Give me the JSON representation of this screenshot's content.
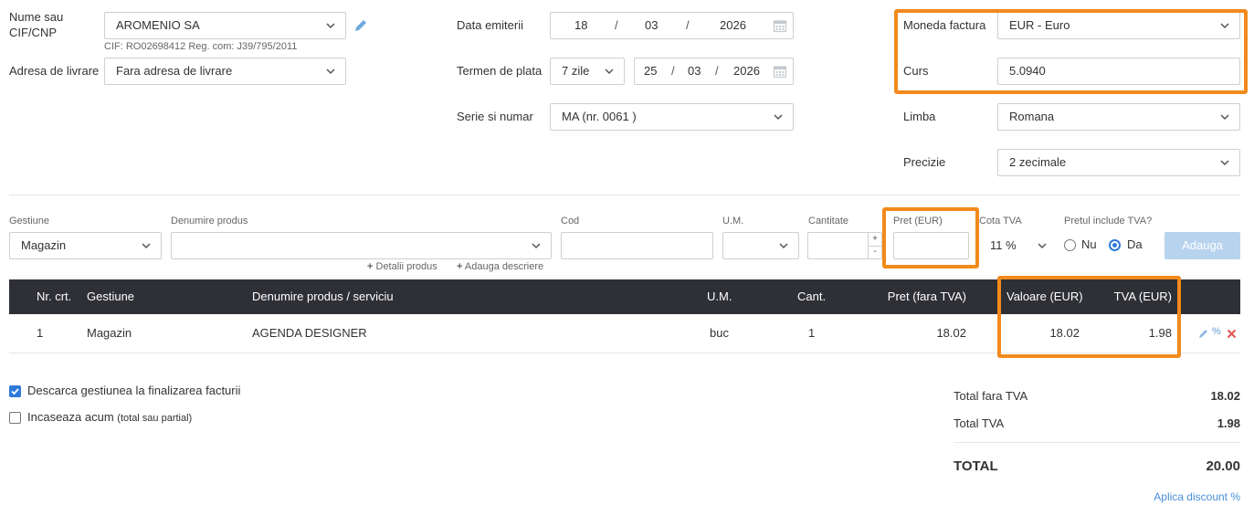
{
  "client": {
    "name_label": "Nume sau CIF/CNP",
    "name_value": "AROMENIO SA",
    "cif_info": "CIF: RO02698412 Reg. com: J39/795/2011",
    "address_label": "Adresa de livrare",
    "address_value": "Fara adresa de livrare"
  },
  "dates": {
    "issue_label": "Data emiterii",
    "issue_day": "18",
    "issue_month": "03",
    "issue_year": "2026",
    "term_label": "Termen de plata",
    "term_value": "7 zile",
    "due_day": "25",
    "due_month": "03",
    "due_year": "2026",
    "separator": "/",
    "series_label": "Serie si numar",
    "series_value": "MA (nr. 0061 )"
  },
  "settings": {
    "currency_label": "Moneda factura",
    "currency_value": "EUR - Euro",
    "rate_label": "Curs",
    "rate_value": "5.0940",
    "language_label": "Limba",
    "language_value": "Romana",
    "precision_label": "Precizie",
    "precision_value": "2 zecimale"
  },
  "product_form": {
    "stock_label": "Gestiune",
    "stock_value": "Magazin",
    "product_label": "Denumire produs",
    "product_value": "",
    "code_label": "Cod",
    "um_label": "U.M.",
    "qty_label": "Cantitate",
    "price_label": "Pret (EUR)",
    "vat_label": "Cota TVA",
    "vat_value": "11 %",
    "includes_vat_label": "Pretul include TVA?",
    "no_label": "Nu",
    "yes_label": "Da",
    "add_button": "Adauga",
    "product_details": "Detalii produs",
    "add_description": "Adauga descriere",
    "plus": "+",
    "minus": "-"
  },
  "table": {
    "headers": {
      "nr": "Nr. crt.",
      "stock": "Gestiune",
      "name": "Denumire produs / serviciu",
      "um": "U.M.",
      "qty": "Cant.",
      "price": "Pret (fara TVA)",
      "value": "Valoare (EUR)",
      "vat": "TVA (EUR)"
    },
    "rows": [
      {
        "nr": "1",
        "stock": "Magazin",
        "name": "AGENDA DESIGNER",
        "um": "buc",
        "qty": "1",
        "price": "18.02",
        "value": "18.02",
        "vat": "1.98",
        "discount_icon": "%"
      }
    ]
  },
  "options": {
    "discharge_label": "Descarca gestiunea la finalizarea facturii",
    "discharge_checked": true,
    "collect_label": "Incaseaza acum",
    "collect_note": "(total sau partial)",
    "collect_checked": false
  },
  "totals": {
    "net_label": "Total fara TVA",
    "net_value": "18.02",
    "vat_label": "Total TVA",
    "vat_value": "1.98",
    "total_label": "TOTAL",
    "total_value": "20.00",
    "discount_link": "Aplica discount %"
  },
  "colors": {
    "highlight": "#f28a1c",
    "table_header": "#2f3036",
    "link": "#4a90d9",
    "add_button": "#b8d3ee",
    "delete": "#e05a5a"
  }
}
